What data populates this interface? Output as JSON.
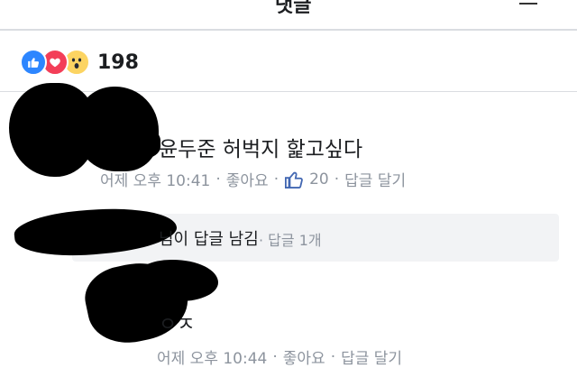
{
  "topbar": {
    "title": "댓글"
  },
  "reactions": {
    "icons": [
      "like-icon",
      "love-icon",
      "wow-icon"
    ],
    "count": "198"
  },
  "comments": [
    {
      "text": "윤두준 허벅지 핥고싶다",
      "time": "어제 오후 10:41",
      "like_action": "좋아요",
      "like_count": "20",
      "reply_action": "답글 달기"
    },
    {
      "text": "ㅇㅈ",
      "time": "어제 오후 10:44",
      "like_action": "좋아요",
      "reply_action": "답글 달기"
    }
  ],
  "reply_summary": {
    "text": "님이 답글 남김",
    "count": "· 답글 1개"
  },
  "colors": {
    "like_blue": "#2d86ff",
    "love_red": "#f33e58",
    "wow_yellow": "#fcd462",
    "meta_gray": "#8d949e",
    "divider": "#dadde1"
  }
}
